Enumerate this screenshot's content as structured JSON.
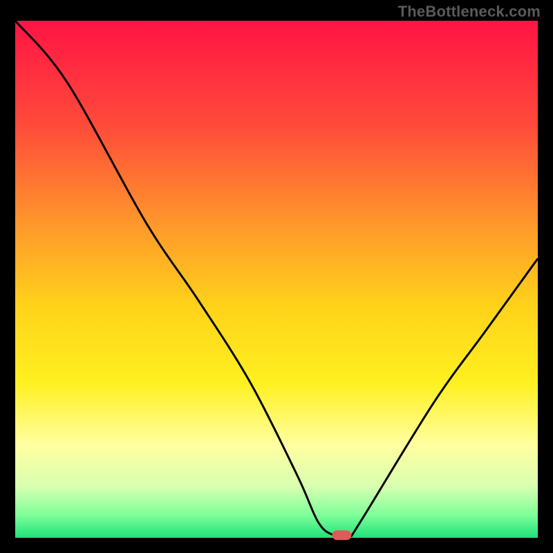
{
  "watermark": "TheBottleneck.com",
  "chart_data": {
    "type": "line",
    "title": "",
    "xlabel": "",
    "ylabel": "",
    "xlim": [
      0,
      100
    ],
    "ylim": [
      0,
      100
    ],
    "grid": false,
    "legend": false,
    "series": [
      {
        "name": "bottleneck-curve",
        "x": [
          0,
          10,
          25,
          35,
          45,
          54,
          58,
          61,
          64,
          66,
          80,
          90,
          100
        ],
        "values": [
          100,
          88,
          61,
          46,
          30,
          12,
          3,
          0.5,
          0.5,
          3,
          26,
          40,
          54
        ]
      }
    ],
    "marker": {
      "x": 62.5,
      "y": 0.5,
      "color": "#e05a5a"
    },
    "gradient_stops": [
      {
        "offset": 0.0,
        "color": "#ff1444"
      },
      {
        "offset": 0.2,
        "color": "#ff4a3a"
      },
      {
        "offset": 0.4,
        "color": "#ff9a2a"
      },
      {
        "offset": 0.55,
        "color": "#ffd21a"
      },
      {
        "offset": 0.7,
        "color": "#fff020"
      },
      {
        "offset": 0.82,
        "color": "#ffffa0"
      },
      {
        "offset": 0.9,
        "color": "#d8ffb0"
      },
      {
        "offset": 0.955,
        "color": "#80ff9a"
      },
      {
        "offset": 1.0,
        "color": "#1fe27a"
      }
    ]
  }
}
